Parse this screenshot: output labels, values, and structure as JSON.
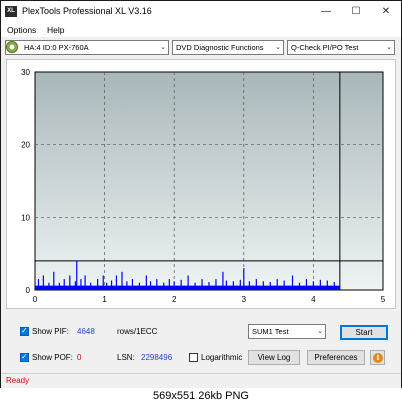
{
  "window": {
    "title": "PlexTools Professional XL V3.16",
    "icon_text": "XL",
    "minimize": "—",
    "maximize": "☐",
    "close": "✕"
  },
  "menu": [
    "Options",
    "Help"
  ],
  "toolbar": {
    "drive": "HA:4 ID:0  PX-760A",
    "function": "DVD Diagnostic Functions",
    "test": "Q-Check PI/PO Test"
  },
  "chart_data": {
    "type": "bar",
    "title": "",
    "xlabel": "",
    "ylabel": "",
    "xlim": [
      0,
      5
    ],
    "ylim": [
      0,
      30
    ],
    "x_ticks": [
      "0",
      "1",
      "2",
      "3",
      "4",
      "5"
    ],
    "y_ticks": [
      "0",
      "10",
      "20",
      "30"
    ],
    "threshold": 4,
    "end_marker": 4.38,
    "grid": true,
    "series": [
      {
        "color": "#0000ff",
        "x": [
          0.05,
          0.12,
          0.2,
          0.27,
          0.35,
          0.42,
          0.5,
          0.58,
          0.6,
          0.66,
          0.72,
          0.8,
          0.9,
          0.98,
          1.03,
          1.1,
          1.17,
          1.25,
          1.32,
          1.4,
          1.5,
          1.6,
          1.66,
          1.75,
          1.85,
          1.93,
          2.0,
          2.1,
          2.2,
          2.3,
          2.4,
          2.5,
          2.6,
          2.7,
          2.75,
          2.85,
          2.95,
          3.0,
          3.08,
          3.18,
          3.28,
          3.38,
          3.48,
          3.58,
          3.7,
          3.8,
          3.9,
          4.0,
          4.1,
          4.2,
          4.3
        ],
        "values": [
          1.5,
          2,
          1,
          2.5,
          1,
          1.5,
          2,
          1.2,
          4,
          1.5,
          2,
          1,
          1.5,
          2,
          1,
          1.3,
          2,
          2.5,
          1.2,
          1.5,
          1,
          2,
          1.2,
          1.5,
          1,
          1.5,
          1.2,
          1.4,
          2,
          1,
          1.5,
          1.1,
          1.5,
          2.5,
          1.3,
          1.2,
          1.4,
          3,
          1.2,
          1.5,
          1.2,
          1.1,
          1.5,
          1.3,
          2,
          1,
          1.5,
          1.2,
          1.4,
          1.3,
          1.1
        ]
      }
    ]
  },
  "controls": {
    "show_pif_label": "Show PIF:",
    "pif_value": "4648",
    "rows_label": "rows/1ECC",
    "show_pof_label": "Show POF:",
    "pof_value": "0",
    "lsn_label": "LSN:",
    "lsn_value": "2298496",
    "logarithmic_label": "Logarithmic",
    "sum_select": "SUM1 Test",
    "start_button": "Start",
    "viewlog_button": "View Log",
    "preferences_button": "Preferences",
    "info_icon_glyph": "i",
    "pif_color": "#1f3fd0",
    "pof_color": "#e00000"
  },
  "status": "Ready",
  "caption": "569x551  26kb  PNG"
}
